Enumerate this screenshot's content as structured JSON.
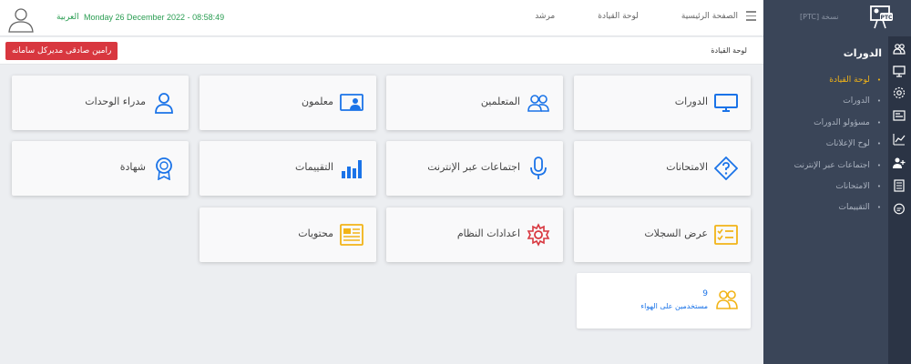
{
  "header": {
    "lang": "العربية",
    "datetime": "Monday 26 December 2022 - 08:58:49",
    "nav": [
      "الصفحة الرئيسية",
      "لوحة القيادة",
      "مرشد"
    ]
  },
  "alert_button": "رامین صادقی مدیرکل سامانه",
  "breadcrumb": "لوحة القيادة",
  "cards": [
    {
      "label": "الدورات",
      "icon": "monitor-icon"
    },
    {
      "label": "المتعلمين",
      "icon": "users-icon"
    },
    {
      "label": "معلمون",
      "icon": "teacher-icon"
    },
    {
      "label": "مدراء الوحدات",
      "icon": "user-icon"
    },
    {
      "label": "الامتحانات",
      "icon": "question-icon"
    },
    {
      "label": "اجتماعات عبر الإنترنت",
      "icon": "microphone-icon"
    },
    {
      "label": "التقييمات",
      "icon": "bar-chart-icon"
    },
    {
      "label": "شهادة",
      "icon": "certificate-icon"
    },
    {
      "label": "عرض السجلات",
      "icon": "checklist-icon"
    },
    {
      "label": "اعدادات النظام",
      "icon": "gear-icon"
    },
    {
      "label": "محتويات",
      "icon": "newspaper-icon"
    }
  ],
  "online": {
    "count": "9",
    "label": "مستخدمين على الهواء"
  },
  "sidebar": {
    "brand": "[PTC] نسخة",
    "title": "الدورات",
    "items": [
      {
        "label": "لوحة القيادة",
        "active": true
      },
      {
        "label": "الدورات"
      },
      {
        "label": "مسؤولو الدورات"
      },
      {
        "label": "لوح الإعلانات"
      },
      {
        "label": "اجتماعات عبر الإنترنت"
      },
      {
        "label": "الامتحانات"
      },
      {
        "label": "التقييمات"
      }
    ]
  },
  "colors": {
    "accent": "#1a73e8",
    "sidebar": "#3a4558",
    "alert": "#d8373f",
    "active": "#f2b417",
    "datetime": "#2a9d52"
  }
}
